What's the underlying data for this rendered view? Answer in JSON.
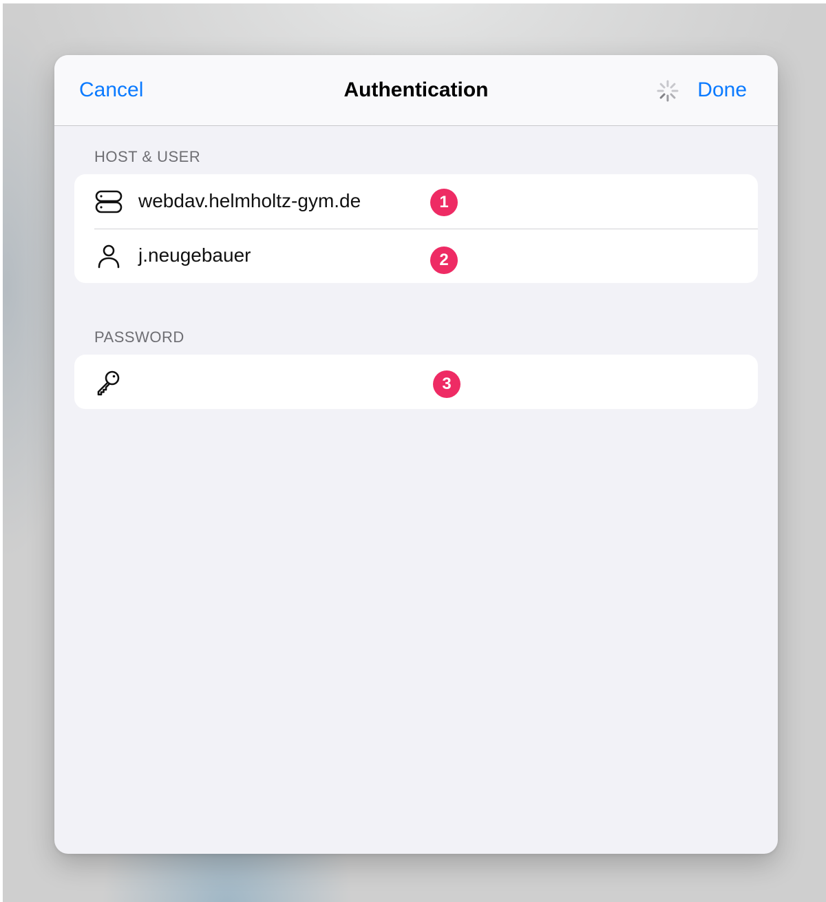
{
  "navbar": {
    "cancel_label": "Cancel",
    "title": "Authentication",
    "done_label": "Done"
  },
  "sections": {
    "host_user": {
      "header": "HOST & USER",
      "host": "webdav.helmholtz-gym.de",
      "username": "j.neugebauer"
    },
    "password": {
      "header": "PASSWORD",
      "value": ""
    }
  },
  "annotations": [
    "1",
    "2",
    "3"
  ],
  "icons": {
    "host": "server-icon",
    "user": "person-icon",
    "password": "key-icon",
    "activity": "activity-spinner-icon"
  },
  "colors": {
    "accent": "#0a7aff",
    "badge": "#ee2b64",
    "background": "#f2f2f7"
  }
}
